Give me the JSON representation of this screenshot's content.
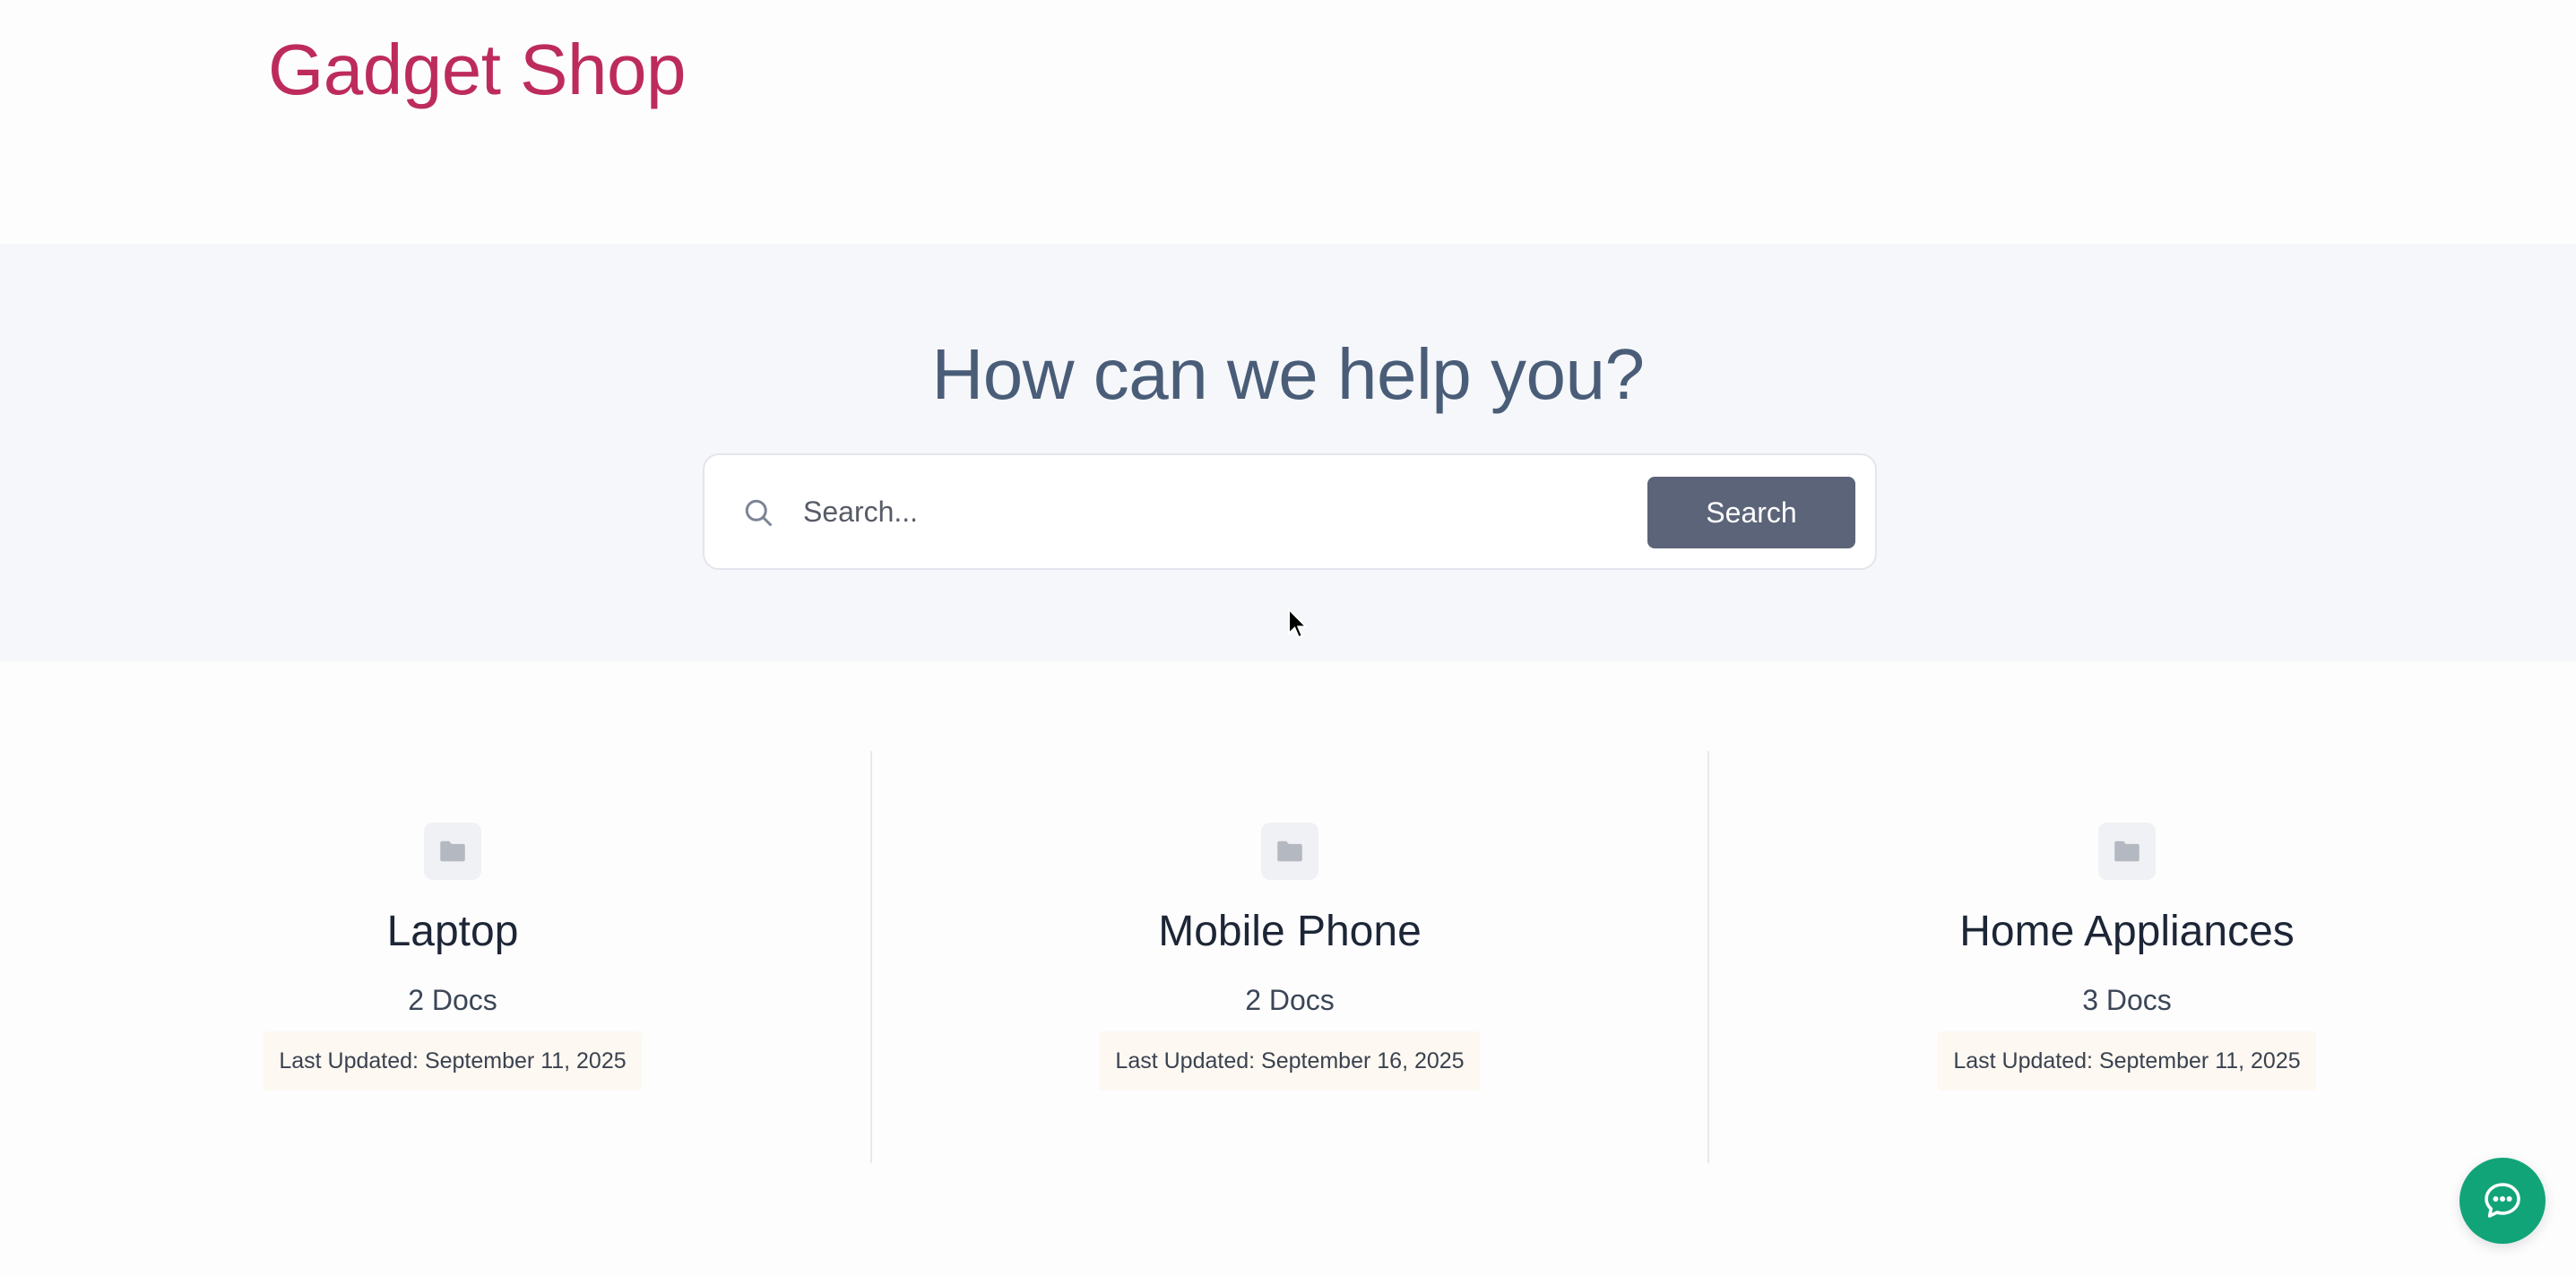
{
  "header": {
    "site_title": "Gadget Shop"
  },
  "hero": {
    "heading": "How can we help you?",
    "search": {
      "placeholder": "Search...",
      "value": "",
      "button_label": "Search",
      "icon": "search-icon"
    }
  },
  "categories": [
    {
      "title": "Laptop",
      "count": "2 Docs",
      "updated": "Last Updated: September 11, 2025",
      "icon": "folder-icon"
    },
    {
      "title": "Mobile Phone",
      "count": "2 Docs",
      "updated": "Last Updated: September 16, 2025",
      "icon": "folder-icon"
    },
    {
      "title": "Home Appliances",
      "count": "3 Docs",
      "updated": "Last Updated: September 11, 2025",
      "icon": "folder-icon"
    }
  ],
  "chat": {
    "icon": "chat-bubble-icon"
  },
  "colors": {
    "brand": "#bd2b5c",
    "heading": "#4a5d78",
    "search_button": "#5b6478",
    "chat_button": "#12a479",
    "hero_background": "#f6f7fa"
  }
}
